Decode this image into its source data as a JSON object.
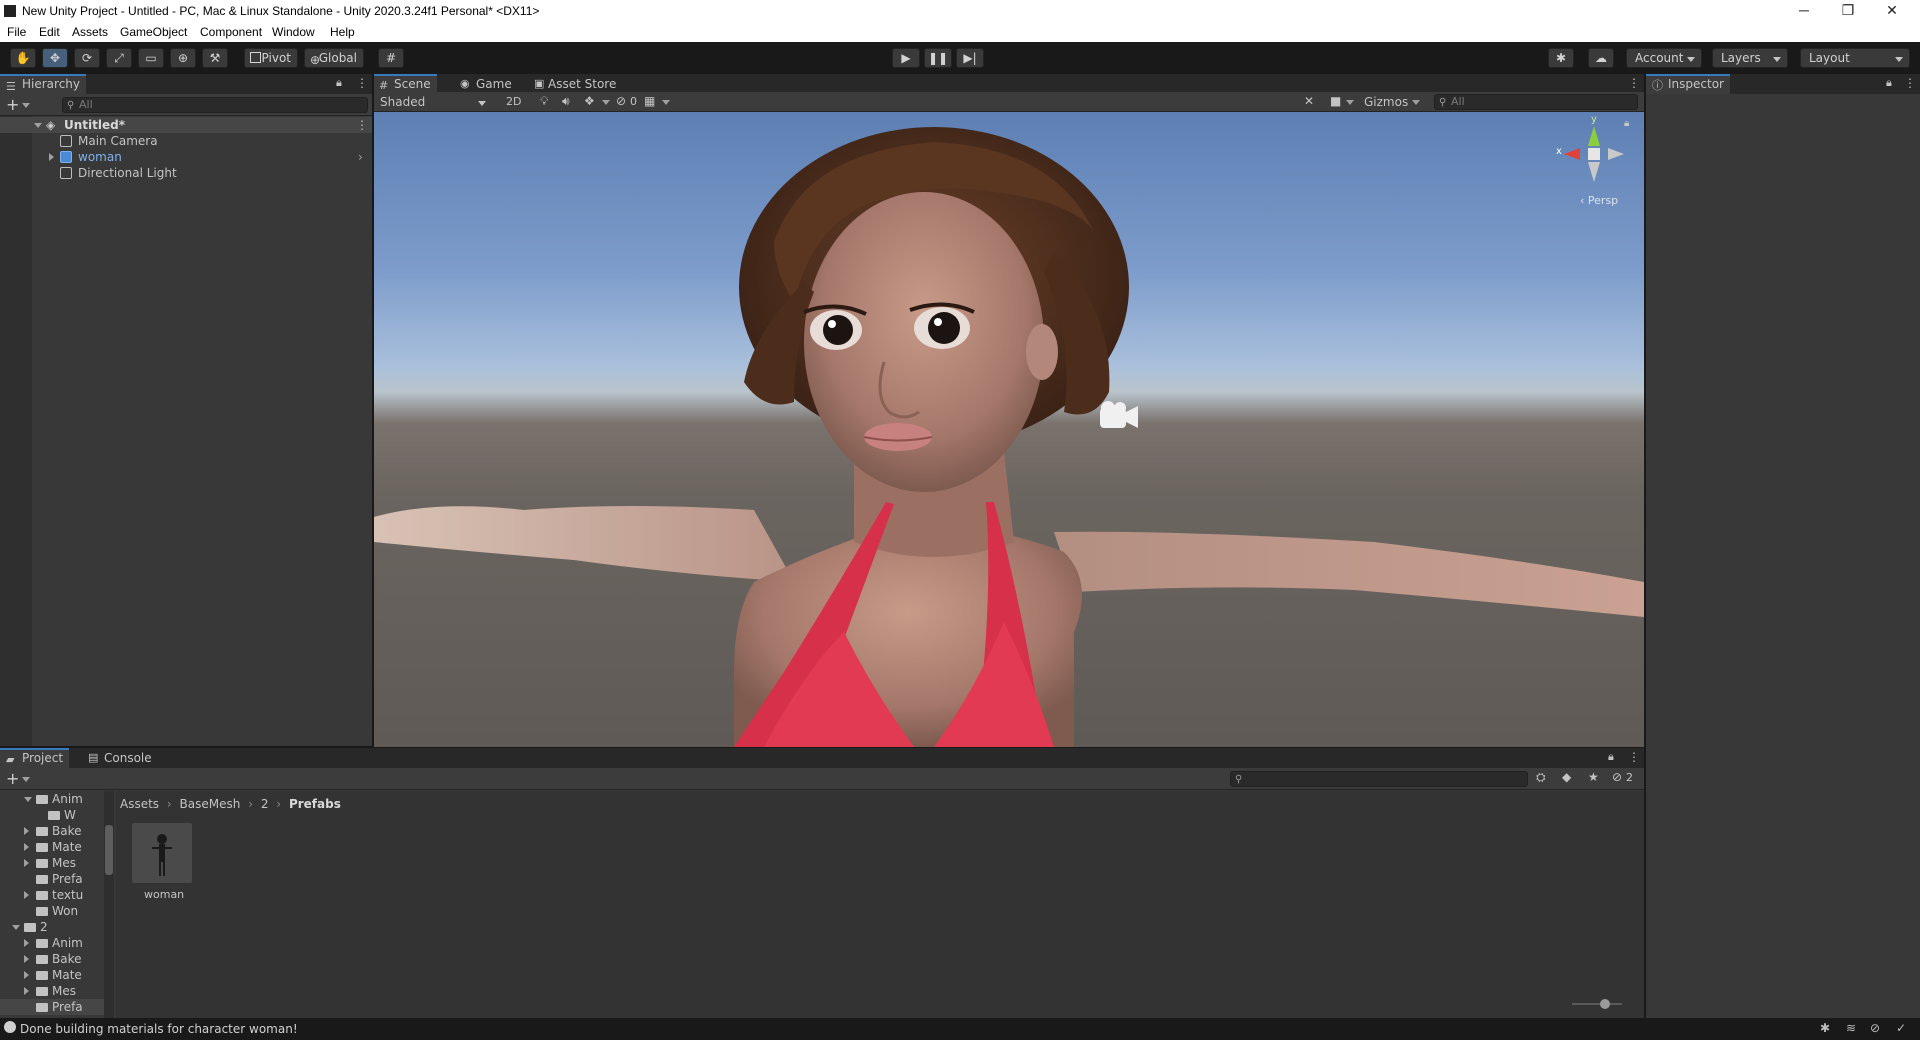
{
  "window": {
    "title": "New Unity Project - Untitled - PC, Mac & Linux Standalone - Unity 2020.3.24f1 Personal* <DX11>",
    "minimize": "─",
    "restore": "❐",
    "close": "✕"
  },
  "menu": [
    "File",
    "Edit",
    "Assets",
    "GameObject",
    "Component",
    "Window",
    "Help"
  ],
  "toolbar": {
    "pivot": "Pivot",
    "global": "Global",
    "account": "Account",
    "layers": "Layers",
    "layout": "Layout"
  },
  "hierarchy": {
    "tab": "Hierarchy",
    "search_placeholder": "All",
    "scene_name": "Untitled*",
    "items": [
      "Main Camera",
      "woman",
      "Directional Light"
    ]
  },
  "scene_view": {
    "tabs": [
      "Scene",
      "Game",
      "Asset Store"
    ],
    "shading_mode": "Shaded",
    "mode_2d": "2D",
    "hidden_count": "0",
    "gizmos": "Gizmos",
    "search_placeholder": "All",
    "axis_y": "y",
    "axis_x": "x",
    "projection": "Persp"
  },
  "inspector": {
    "tab": "Inspector"
  },
  "project": {
    "tabs": [
      "Project",
      "Console"
    ],
    "breadcrumb": [
      "Assets",
      "BaseMesh",
      "2",
      "Prefabs"
    ],
    "tree": [
      {
        "label": "Anim",
        "indent": 2,
        "arrow": "down"
      },
      {
        "label": "W",
        "indent": 3,
        "arrow": ""
      },
      {
        "label": "Bake",
        "indent": 2,
        "arrow": "right"
      },
      {
        "label": "Mate",
        "indent": 2,
        "arrow": "right"
      },
      {
        "label": "Mes",
        "indent": 2,
        "arrow": "right"
      },
      {
        "label": "Prefa",
        "indent": 2,
        "arrow": ""
      },
      {
        "label": "textu",
        "indent": 2,
        "arrow": "right"
      },
      {
        "label": "Won",
        "indent": 2,
        "arrow": ""
      },
      {
        "label": "2",
        "indent": 1,
        "arrow": "down"
      },
      {
        "label": "Anim",
        "indent": 2,
        "arrow": "right"
      },
      {
        "label": "Bake",
        "indent": 2,
        "arrow": "right"
      },
      {
        "label": "Mate",
        "indent": 2,
        "arrow": "right"
      },
      {
        "label": "Mes",
        "indent": 2,
        "arrow": "right"
      },
      {
        "label": "Prefa",
        "indent": 2,
        "arrow": ""
      }
    ],
    "asset_name": "woman",
    "hidden_count": "2"
  },
  "status": {
    "message": "Done building materials for character woman!"
  },
  "colors": {
    "accent": "#3a79bb",
    "panel": "#383838",
    "prefab_blue": "#7fb0ea"
  }
}
